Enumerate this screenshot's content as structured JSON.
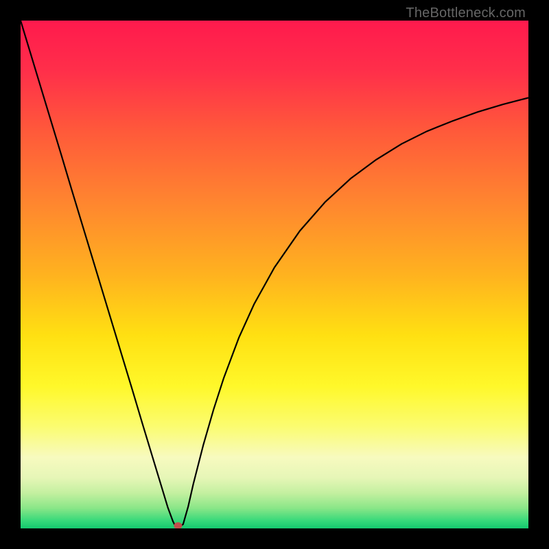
{
  "watermark": "TheBottleneck.com",
  "chart_data": {
    "type": "line",
    "title": "",
    "xlabel": "",
    "ylabel": "",
    "xlim": [
      0,
      100
    ],
    "ylim": [
      0,
      100
    ],
    "background_gradient": {
      "stops": [
        {
          "offset": 0.0,
          "color": "#ff1a4d"
        },
        {
          "offset": 0.1,
          "color": "#ff2f4a"
        },
        {
          "offset": 0.22,
          "color": "#ff5a3a"
        },
        {
          "offset": 0.35,
          "color": "#ff8330"
        },
        {
          "offset": 0.5,
          "color": "#ffb21f"
        },
        {
          "offset": 0.62,
          "color": "#ffe012"
        },
        {
          "offset": 0.72,
          "color": "#fff82a"
        },
        {
          "offset": 0.8,
          "color": "#fbfc71"
        },
        {
          "offset": 0.86,
          "color": "#f7fabf"
        },
        {
          "offset": 0.9,
          "color": "#e6f6b7"
        },
        {
          "offset": 0.93,
          "color": "#c4f0a0"
        },
        {
          "offset": 0.96,
          "color": "#8ae688"
        },
        {
          "offset": 0.985,
          "color": "#36d97a"
        },
        {
          "offset": 1.0,
          "color": "#14c86e"
        }
      ]
    },
    "series": [
      {
        "name": "bottleneck-curve",
        "color": "#000000",
        "x": [
          0,
          2,
          4,
          6,
          8,
          10,
          12,
          14,
          16,
          18,
          20,
          22,
          24,
          26,
          27,
          28,
          29,
          30,
          30.5,
          31,
          32,
          33,
          34,
          36,
          38,
          40,
          43,
          46,
          50,
          55,
          60,
          65,
          70,
          75,
          80,
          85,
          90,
          95,
          100
        ],
        "y": [
          100,
          93.4,
          86.8,
          80.2,
          73.6,
          66.9,
          60.3,
          53.7,
          47.1,
          40.5,
          33.9,
          27.3,
          20.6,
          14.0,
          10.7,
          7.4,
          4.1,
          1.4,
          0.4,
          0.2,
          0.8,
          4.3,
          8.7,
          16.5,
          23.4,
          29.6,
          37.6,
          44.2,
          51.4,
          58.6,
          64.3,
          68.9,
          72.6,
          75.7,
          78.2,
          80.2,
          82.0,
          83.5,
          84.8
        ]
      }
    ],
    "marker": {
      "name": "optimal-point",
      "x": 31,
      "y": 0,
      "color": "#c0504d"
    }
  }
}
